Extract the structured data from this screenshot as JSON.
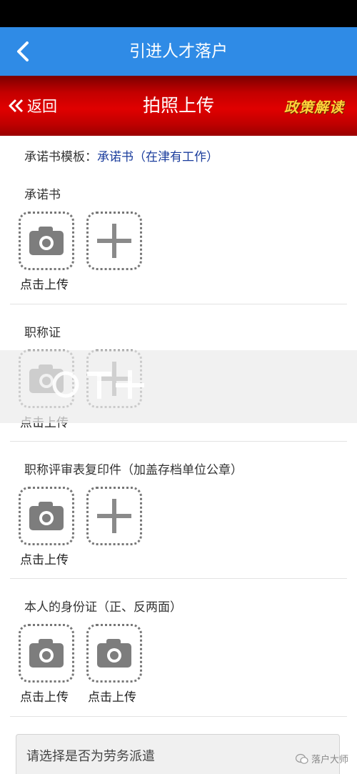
{
  "app_header": {
    "title": "引进人才落户"
  },
  "sub_header": {
    "back_label": "返回",
    "title": "拍照上传",
    "policy_label": "政策解读"
  },
  "template": {
    "label": "承诺书模板：",
    "link_text": "承诺书（在津有工作）"
  },
  "sections": [
    {
      "title": "承诺书",
      "caption": "点击上传"
    },
    {
      "title": "职称证",
      "caption": "点击上传"
    },
    {
      "title": "职称评审表复印件（加盖存档单位公章）",
      "caption": "点击上传"
    },
    {
      "title": "本人的身份证（正、反两面）",
      "captions": [
        "点击上传",
        "点击上传"
      ]
    }
  ],
  "select": {
    "placeholder": "请选择是否为劳务派遣"
  },
  "watermark": {
    "text": "落户大师"
  },
  "colors": {
    "header_blue": "#2f8be6",
    "banner_red": "#e00000",
    "policy_gold": "#ffd23a",
    "link_blue": "#1a3c9c"
  }
}
